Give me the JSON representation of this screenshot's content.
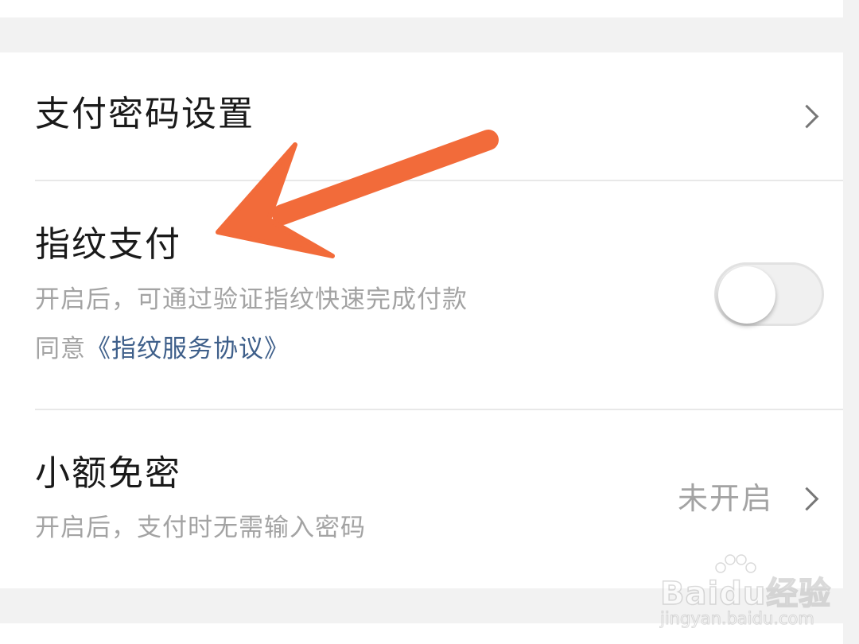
{
  "settings": {
    "pay_password": {
      "title": "支付密码设置"
    },
    "fingerprint": {
      "title": "指纹支付",
      "description": "开启后，可通过验证指纹快速完成付款",
      "agree_prefix": "同意",
      "agree_link": "《指纹服务协议》",
      "toggle_on": false
    },
    "small_free": {
      "title": "小额免密",
      "description": "开启后，支付时无需输入密码",
      "status": "未开启"
    }
  },
  "watermark": {
    "logo": "Baidu经验",
    "url": "jingyan.baidu.com"
  },
  "colors": {
    "annotation_arrow": "#f26b3a",
    "link": "#3e5f8a",
    "secondary_text": "#a3a3a3",
    "background": "#f2f2f2"
  },
  "icons": {
    "chevron": "chevron-right-icon",
    "annotation": "arrow-annotation-icon"
  }
}
